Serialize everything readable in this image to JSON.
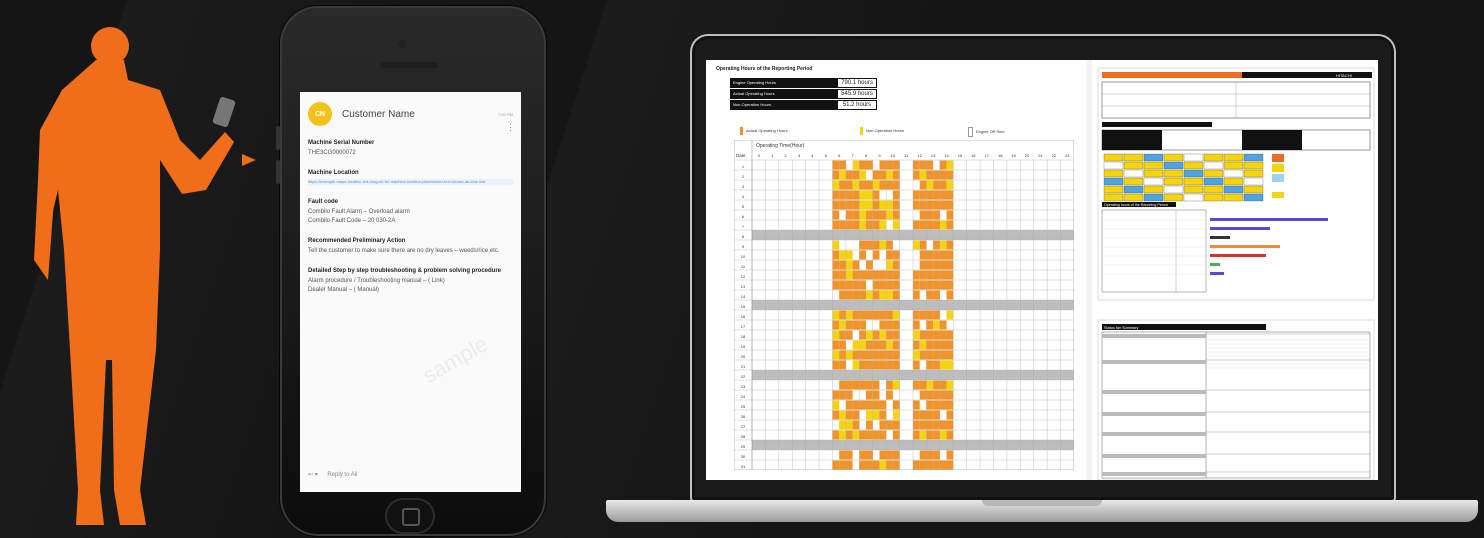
{
  "phone": {
    "sender_initials": "CN",
    "sender_name": "Customer Name",
    "meta_time": "7:00 PM",
    "sections": [
      {
        "heading": "Machine Serial Number",
        "value": "THE3CG0000072"
      },
      {
        "heading": "Machine Location",
        "value": "",
        "link": "https://example-maps-location-link-long-url-for-machine-location-placeholder-text-shown-as-blue-link"
      },
      {
        "heading": "Fault code",
        "value": "Combilo Fault Alarm – Overload alarm",
        "value2": "Combilo Fault Code – 20 030-2A"
      },
      {
        "heading": "Recommended Preliminary Action",
        "value": "Tell the customer to make sure there are no dry leaves – weeds/rice etc."
      },
      {
        "heading": "Detailed Step by step troubleshooting & problem solving procedure",
        "value": "Alarm procedure / Troubleshooting manual – ( Link)",
        "value2": "Dealer Manual – ( Manual)"
      }
    ],
    "reply_label": "Reply to All",
    "watermark": "sample"
  },
  "report": {
    "title": "Operating Hours of the Reporting Period",
    "stats": [
      {
        "label": "Engine Operating Hours",
        "value": "790.1 hours"
      },
      {
        "label": "Actual Operating Hours",
        "value": "545.9 hours"
      },
      {
        "label": "Non-Operation Hours",
        "value": "51.2 hours"
      }
    ],
    "legend": [
      {
        "label": "Actual Operating Hours",
        "color": "#f0932b"
      },
      {
        "label": "Non-Operation Hours",
        "color": "#f5d40f"
      },
      {
        "label": "Engine Off Time",
        "color": "#ffffff"
      }
    ],
    "timechart_label": "Operating Time(Hour)",
    "date_label": "Date",
    "hours": [
      "0",
      "1",
      "2",
      "3",
      "4",
      "5",
      "6",
      "7",
      "8",
      "9",
      "10",
      "11",
      "12",
      "13",
      "14",
      "15",
      "16",
      "17",
      "18",
      "19",
      "20",
      "21",
      "22",
      "23"
    ],
    "days": [
      "1",
      "2",
      "3",
      "4",
      "5",
      "6",
      "7",
      "8",
      "9",
      "10",
      "11",
      "12",
      "13",
      "14",
      "15",
      "16",
      "17",
      "18",
      "19",
      "20",
      "21",
      "22",
      "23",
      "24",
      "25",
      "26",
      "27",
      "28",
      "29",
      "30",
      "31"
    ],
    "right_header": "HITACHI",
    "right_section_title": "Operating hours of the Reporting Period",
    "summary_title": "Status fan Summary"
  },
  "colors": {
    "operating": "#f0932b",
    "non_operation": "#f5d40f",
    "gray_row": "#bdbdbd",
    "accent_orange": "#ef6c1f",
    "person": "#f06d1a"
  }
}
